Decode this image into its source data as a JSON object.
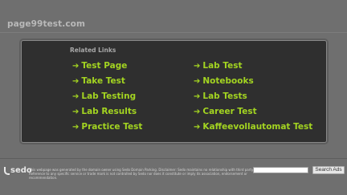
{
  "site": {
    "domain": "page99test.com"
  },
  "related": {
    "title": "Related Links",
    "links": [
      "Test Page",
      "Take Test",
      "Lab Testing",
      "Lab Results",
      "Practice Test",
      "Lab Test",
      "Notebooks",
      "Lab Tests",
      "Career Test",
      "Kaffeevollautomat Test"
    ]
  },
  "footer": {
    "logo": "sedo",
    "disclaimer": "This webpage was generated by the domain owner using Sedo Domain Parking. Disclaimer: Sedo maintains no relationship with third party advertisers. Reference to any specific service or trade mark is not controlled by Sedo nor does it constitute or imply its association, endorsement or recommendation.",
    "search_placeholder": "",
    "search_button": "Search Ads"
  },
  "colors": {
    "link": "#a3d421",
    "panel": "#2f2f2f",
    "background": "#6f6f6f"
  },
  "icons": {
    "link_arrow": "arrow-right-icon"
  }
}
